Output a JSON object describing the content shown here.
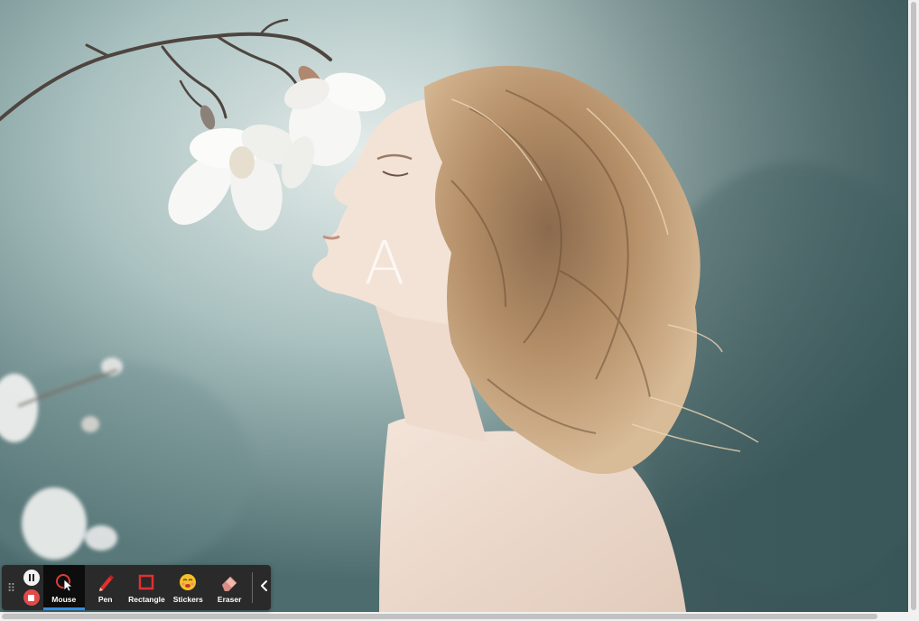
{
  "stage": {
    "overlay_letter": "A"
  },
  "toolbar": {
    "drag_handle_glyph": "⠿",
    "recording": {
      "pause_icon": "pause-icon",
      "stop_icon": "stop-icon"
    },
    "tools": [
      {
        "label": "Mouse",
        "icon": "mouse-cursor-icon",
        "active": true
      },
      {
        "label": "Pen",
        "icon": "pen-icon",
        "active": false
      },
      {
        "label": "Rectangle",
        "icon": "rectangle-icon",
        "active": false
      },
      {
        "label": "Stickers",
        "icon": "sticker-emoji-icon",
        "active": false
      },
      {
        "label": "Eraser",
        "icon": "eraser-icon",
        "active": false
      }
    ],
    "collapse_icon": "chevron-left-icon"
  },
  "colors": {
    "toolbar_bg": "#2a2a2a",
    "active_tool_bg": "#0d0d0d",
    "active_indicator": "#2f8fe8",
    "stop_red": "#e04a4a",
    "pen_red": "#e03030",
    "rectangle_red": "#e03030",
    "sticker_yellow": "#f5c02a"
  }
}
